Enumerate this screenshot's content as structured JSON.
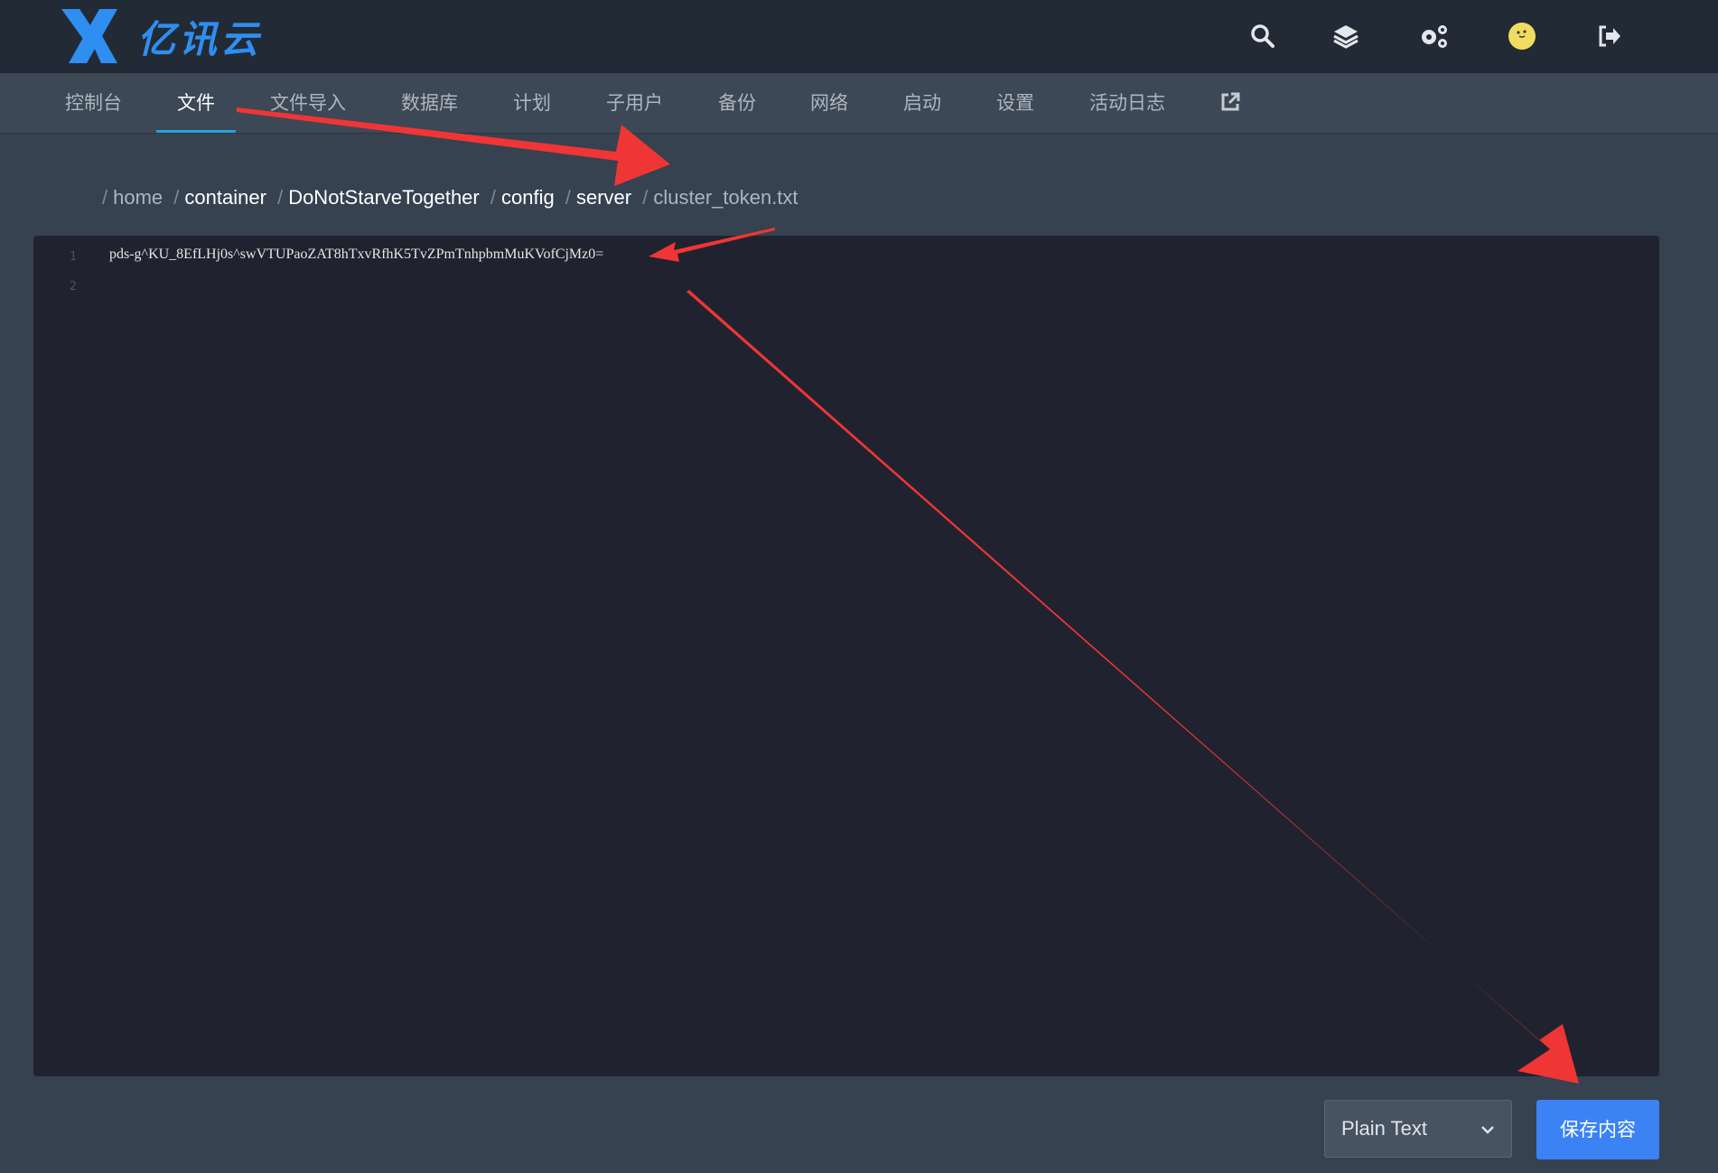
{
  "brand": {
    "name": "亿讯云",
    "color": "#2e8ff0"
  },
  "top_icons": [
    "search-icon",
    "layers-icon",
    "gears-icon",
    "avatar",
    "logout-icon"
  ],
  "nav": {
    "items": [
      {
        "label": "控制台"
      },
      {
        "label": "文件"
      },
      {
        "label": "文件导入"
      },
      {
        "label": "数据库"
      },
      {
        "label": "计划"
      },
      {
        "label": "子用户"
      },
      {
        "label": "备份"
      },
      {
        "label": "网络"
      },
      {
        "label": "启动"
      },
      {
        "label": "设置"
      },
      {
        "label": "活动日志"
      }
    ],
    "active": "文件",
    "external_icon": "external-link-icon"
  },
  "breadcrumb": {
    "home": "home",
    "parts": [
      "container",
      "DoNotStarveTogether",
      "config",
      "server"
    ],
    "current": "cluster_token.txt"
  },
  "editor": {
    "lines": [
      {
        "no": "1",
        "text": "pds-g^KU_8EfLHj0s^swVTUPaoZAT8hTxvRfhK5TvZPmTnhpbmMuKVofCjMz0="
      },
      {
        "no": "2",
        "text": ""
      }
    ]
  },
  "footer": {
    "mode": "Plain Text",
    "save_label": "保存内容"
  },
  "colors": {
    "accent": "#3b82f5",
    "active_tab_underline": "#27a2d8",
    "annotation_arrow": "#f03535"
  }
}
